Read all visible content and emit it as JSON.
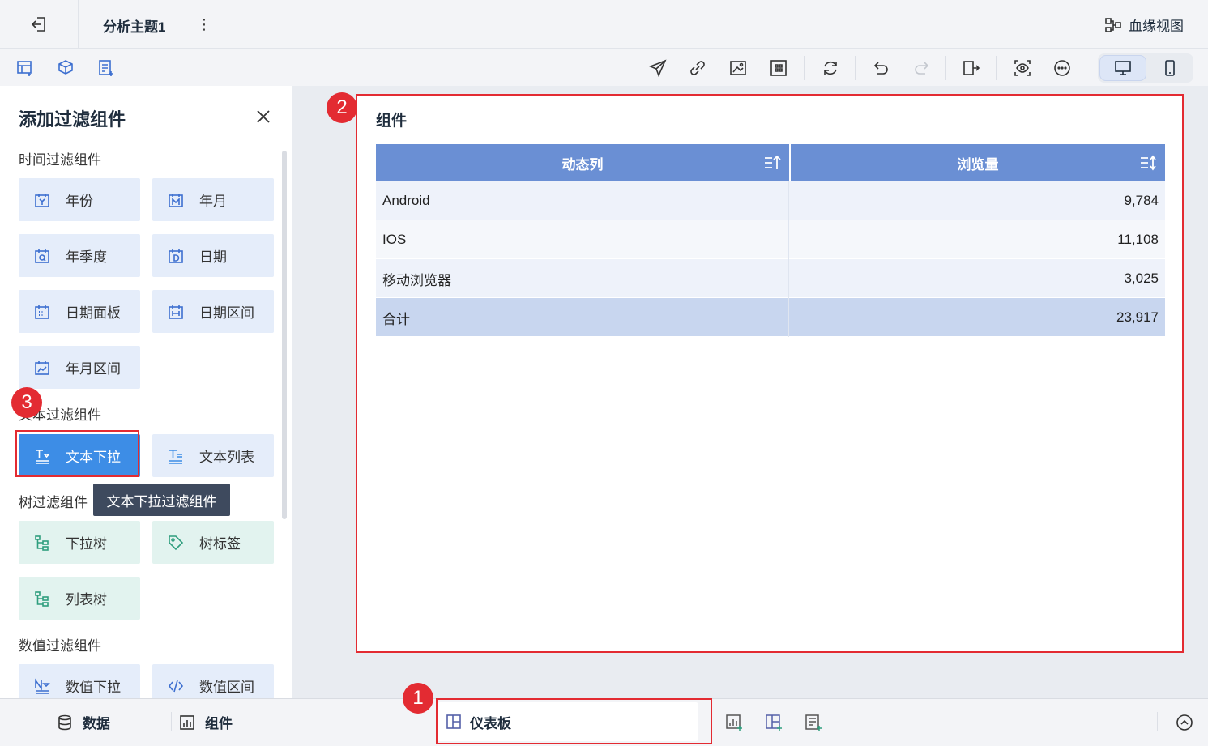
{
  "topbar": {
    "topic_title": "分析主题1",
    "more": "⋮",
    "lineage_label": "血缘视图"
  },
  "panel": {
    "title": "添加过滤组件",
    "sections": {
      "time": "时间过滤组件",
      "text": "文本过滤组件",
      "tree": "树过滤组件",
      "number": "数值过滤组件"
    },
    "time_items": [
      "年份",
      "年月",
      "年季度",
      "日期",
      "日期面板",
      "日期区间",
      "年月区间"
    ],
    "text_items": [
      "文本下拉",
      "文本列表"
    ],
    "tree_items": [
      "下拉树",
      "树标签",
      "列表树"
    ],
    "number_items": [
      "数值下拉",
      "数值区间"
    ],
    "tooltip": "文本下拉过滤组件"
  },
  "widget": {
    "title": "组件",
    "table": {
      "headers": [
        "动态列",
        "浏览量"
      ],
      "rows": [
        [
          "Android",
          "9,784"
        ],
        [
          "IOS",
          "11,108"
        ],
        [
          "移动浏览器",
          "3,025"
        ]
      ],
      "total": [
        "合计",
        "23,917"
      ]
    }
  },
  "bottombar": {
    "data_label": "数据",
    "widget_label": "组件",
    "dashboard_label": "仪表板"
  },
  "annotations": {
    "badge1": "1",
    "badge2": "2",
    "badge3": "3"
  },
  "colors": {
    "accent": "#3d8de6",
    "header": "#6a8fd4",
    "highlight": "#e32b32"
  }
}
